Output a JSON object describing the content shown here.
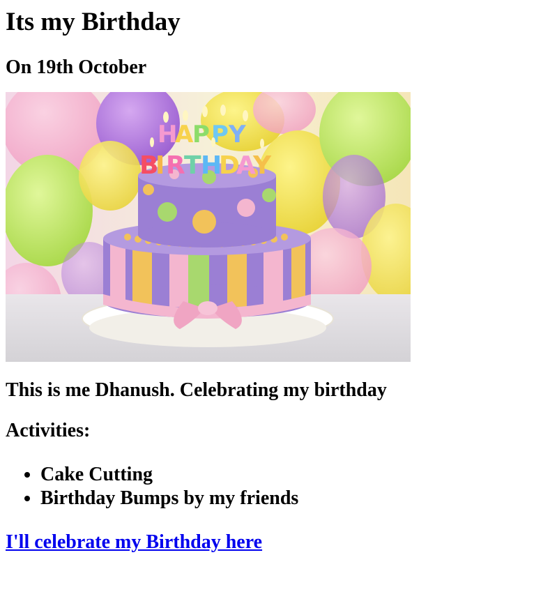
{
  "page": {
    "title": "Its my Birthday",
    "date": "On 19th October",
    "photo": {
      "description_icon": "birthday-cake-photo",
      "candle_text": [
        "HAPPY",
        "BIRTHDAY"
      ]
    },
    "caption": "This is me Dhanush. Celebrating my birthday",
    "activities_heading": "Activities:",
    "activities": [
      "Cake Cutting",
      "Birthday Bumps by my friends"
    ],
    "link_text": "I'll celebrate my Birthday here"
  },
  "colors": {
    "link": "#0000ee",
    "cake_purple": "#9b7fd4",
    "ribbon_pink": "#f4b6cf",
    "stripe_yellow": "#f2c25a",
    "stripe_green": "#a8d86e"
  }
}
